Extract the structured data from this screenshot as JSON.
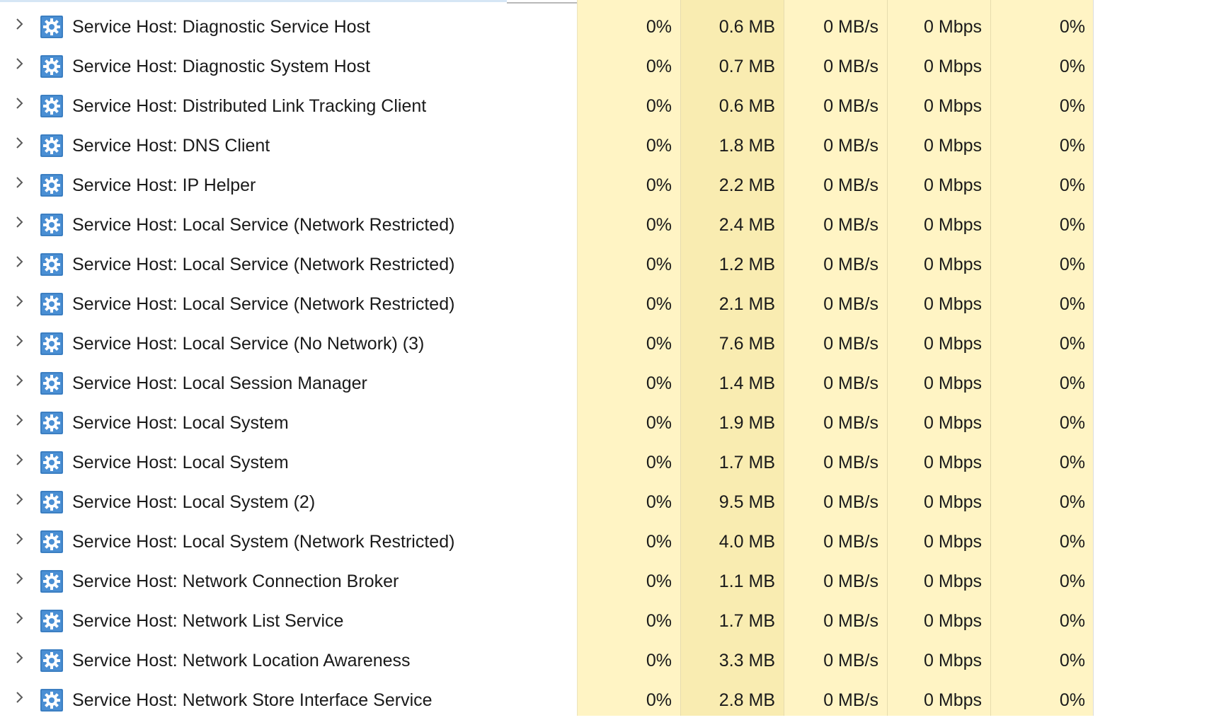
{
  "colors": {
    "cpu_column_bg": "#fff4c4",
    "memory_column_bg": "#f9ecb1",
    "gear_icon_bg": "#4a8fd4"
  },
  "processes": [
    {
      "name": "Service Host: Diagnostic Service Host",
      "cpu": "0%",
      "memory": "0.6 MB",
      "disk": "0 MB/s",
      "network": "0 Mbps",
      "gpu": "0%"
    },
    {
      "name": "Service Host: Diagnostic System Host",
      "cpu": "0%",
      "memory": "0.7 MB",
      "disk": "0 MB/s",
      "network": "0 Mbps",
      "gpu": "0%"
    },
    {
      "name": "Service Host: Distributed Link Tracking Client",
      "cpu": "0%",
      "memory": "0.6 MB",
      "disk": "0 MB/s",
      "network": "0 Mbps",
      "gpu": "0%"
    },
    {
      "name": "Service Host: DNS Client",
      "cpu": "0%",
      "memory": "1.8 MB",
      "disk": "0 MB/s",
      "network": "0 Mbps",
      "gpu": "0%"
    },
    {
      "name": "Service Host: IP Helper",
      "cpu": "0%",
      "memory": "2.2 MB",
      "disk": "0 MB/s",
      "network": "0 Mbps",
      "gpu": "0%"
    },
    {
      "name": "Service Host: Local Service (Network Restricted)",
      "cpu": "0%",
      "memory": "2.4 MB",
      "disk": "0 MB/s",
      "network": "0 Mbps",
      "gpu": "0%"
    },
    {
      "name": "Service Host: Local Service (Network Restricted)",
      "cpu": "0%",
      "memory": "1.2 MB",
      "disk": "0 MB/s",
      "network": "0 Mbps",
      "gpu": "0%"
    },
    {
      "name": "Service Host: Local Service (Network Restricted)",
      "cpu": "0%",
      "memory": "2.1 MB",
      "disk": "0 MB/s",
      "network": "0 Mbps",
      "gpu": "0%"
    },
    {
      "name": "Service Host: Local Service (No Network) (3)",
      "cpu": "0%",
      "memory": "7.6 MB",
      "disk": "0 MB/s",
      "network": "0 Mbps",
      "gpu": "0%"
    },
    {
      "name": "Service Host: Local Session Manager",
      "cpu": "0%",
      "memory": "1.4 MB",
      "disk": "0 MB/s",
      "network": "0 Mbps",
      "gpu": "0%"
    },
    {
      "name": "Service Host: Local System",
      "cpu": "0%",
      "memory": "1.9 MB",
      "disk": "0 MB/s",
      "network": "0 Mbps",
      "gpu": "0%"
    },
    {
      "name": "Service Host: Local System",
      "cpu": "0%",
      "memory": "1.7 MB",
      "disk": "0 MB/s",
      "network": "0 Mbps",
      "gpu": "0%"
    },
    {
      "name": "Service Host: Local System (2)",
      "cpu": "0%",
      "memory": "9.5 MB",
      "disk": "0 MB/s",
      "network": "0 Mbps",
      "gpu": "0%"
    },
    {
      "name": "Service Host: Local System (Network Restricted)",
      "cpu": "0%",
      "memory": "4.0 MB",
      "disk": "0 MB/s",
      "network": "0 Mbps",
      "gpu": "0%"
    },
    {
      "name": "Service Host: Network Connection Broker",
      "cpu": "0%",
      "memory": "1.1 MB",
      "disk": "0 MB/s",
      "network": "0 Mbps",
      "gpu": "0%"
    },
    {
      "name": "Service Host: Network List Service",
      "cpu": "0%",
      "memory": "1.7 MB",
      "disk": "0 MB/s",
      "network": "0 Mbps",
      "gpu": "0%"
    },
    {
      "name": "Service Host: Network Location Awareness",
      "cpu": "0%",
      "memory": "3.3 MB",
      "disk": "0 MB/s",
      "network": "0 Mbps",
      "gpu": "0%"
    },
    {
      "name": "Service Host: Network Store Interface Service",
      "cpu": "0%",
      "memory": "2.8 MB",
      "disk": "0 MB/s",
      "network": "0 Mbps",
      "gpu": "0%"
    }
  ]
}
